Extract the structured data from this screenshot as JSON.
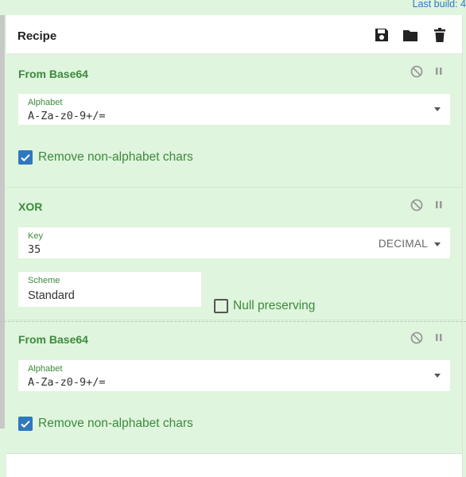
{
  "last_build": "Last build: 4",
  "recipe": {
    "title": "Recipe",
    "icons": [
      "save-icon",
      "folder-icon",
      "trash-icon"
    ]
  },
  "operations": [
    {
      "name": "From Base64",
      "alphabet_label": "Alphabet",
      "alphabet_value": "A-Za-z0-9+/=",
      "checkbox_label": "Remove non-alphabet chars",
      "checked": true
    },
    {
      "name": "XOR",
      "key_label": "Key",
      "key_value": "35",
      "key_format": "DECIMAL",
      "scheme_label": "Scheme",
      "scheme_value": "Standard",
      "null_label": "Null preserving",
      "null_checked": false
    },
    {
      "name": "From Base64",
      "alphabet_label": "Alphabet",
      "alphabet_value": "A-Za-z0-9+/=",
      "checkbox_label": "Remove non-alphabet chars",
      "checked": true
    }
  ],
  "colors": {
    "accent": "#2f78c0",
    "op_bg": "#dff5dd",
    "op_title": "#3c8a3c"
  }
}
